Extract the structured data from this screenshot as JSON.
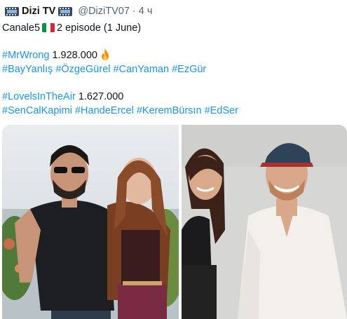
{
  "tweet": {
    "account_name": "Dizi TV",
    "handle": "@DiziTV07",
    "separator": "·",
    "time": "4 ч",
    "line1_channel": "Canale5",
    "line1_rest": "2 episode (1 June)",
    "show1": {
      "hashtag": "#MrWrong",
      "viewers": "1.928.000",
      "tags": [
        "#BayYanlış",
        "#ÖzgeGürel",
        "#CanYaman",
        "#EzGür"
      ]
    },
    "show2": {
      "hashtag": "#LovelsInTheAir",
      "viewers": "1.627.000",
      "tags": [
        "#SenCalKapimi",
        "#HandeErcel",
        "#KeremBürsın",
        "#EdSer"
      ]
    }
  },
  "icons": {
    "header_icon": "tv-icon",
    "flag": "italy-flag-icon",
    "fire": "fire-icon"
  },
  "colors": {
    "hashtag": "#1b95e0",
    "text": "#0f1419",
    "meta": "#536471"
  }
}
